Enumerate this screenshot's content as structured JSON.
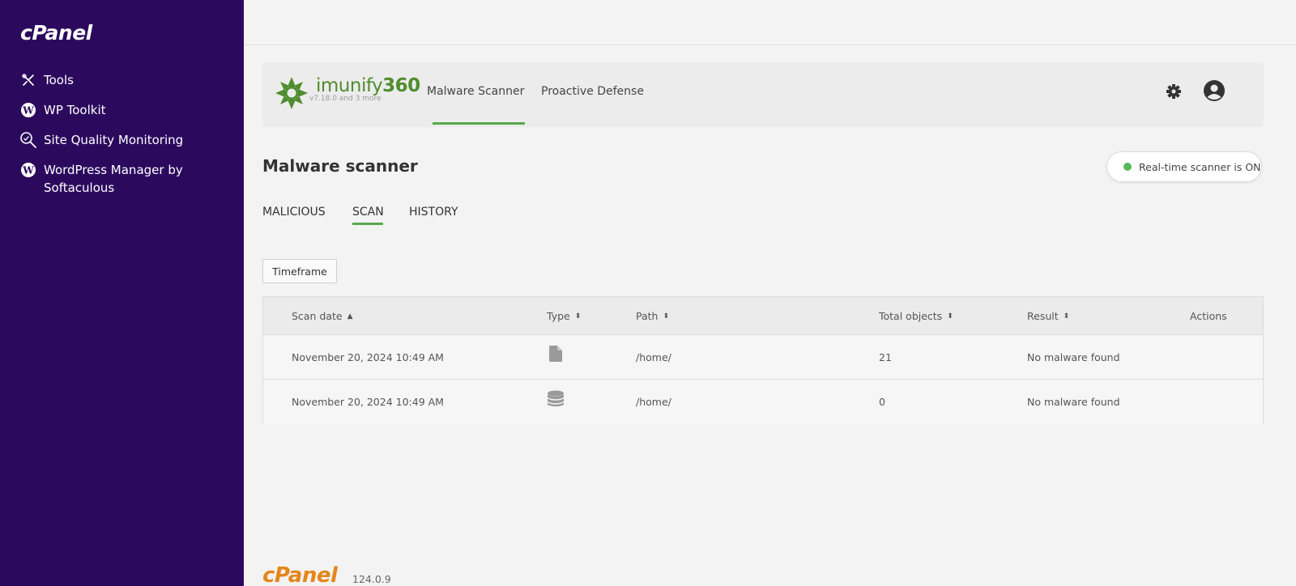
{
  "sidebar": {
    "logo": "cPanel",
    "items": [
      {
        "label": "Tools",
        "icon": "tools-icon"
      },
      {
        "label": "WP Toolkit",
        "icon": "wordpress-icon"
      },
      {
        "label": "Site Quality Monitoring",
        "icon": "search-icon"
      },
      {
        "label": "WordPress Manager by Softaculous",
        "icon": "wordpress-icon"
      }
    ]
  },
  "header": {
    "brand_name": "imunify",
    "brand_number": "360",
    "version": "v7.18.0 and 3 more",
    "tabs": [
      {
        "label": "Malware Scanner",
        "active": true
      },
      {
        "label": "Proactive Defense",
        "active": false
      }
    ],
    "icons": [
      "gear-icon",
      "user-avatar-icon"
    ]
  },
  "main": {
    "title": "Malware scanner",
    "realtime_status": "Real-time scanner is ON",
    "status_color": "#57b85a",
    "subtabs": [
      {
        "label": "MALICIOUS",
        "active": false
      },
      {
        "label": "SCAN",
        "active": true
      },
      {
        "label": "HISTORY",
        "active": false
      }
    ],
    "timeframe_label": "Timeframe",
    "table": {
      "columns": [
        "Scan date",
        "Type",
        "Path",
        "Total objects",
        "Result",
        "Actions"
      ],
      "rows": [
        {
          "scan_date": "November 20, 2024 10:49 AM",
          "type": "file-icon",
          "path": "/home/",
          "total_objects": "21",
          "result": "No malware found"
        },
        {
          "scan_date": "November 20, 2024 10:49 AM",
          "type": "database-icon",
          "path": "/home/",
          "total_objects": "0",
          "result": "No malware found"
        }
      ]
    }
  },
  "footer": {
    "logo": "cPanel",
    "version": "124.0.9"
  },
  "colors": {
    "sidebar_bg": "#2b0a5e",
    "accent_green": "#57a94b",
    "brand_orange": "#e5861a"
  }
}
